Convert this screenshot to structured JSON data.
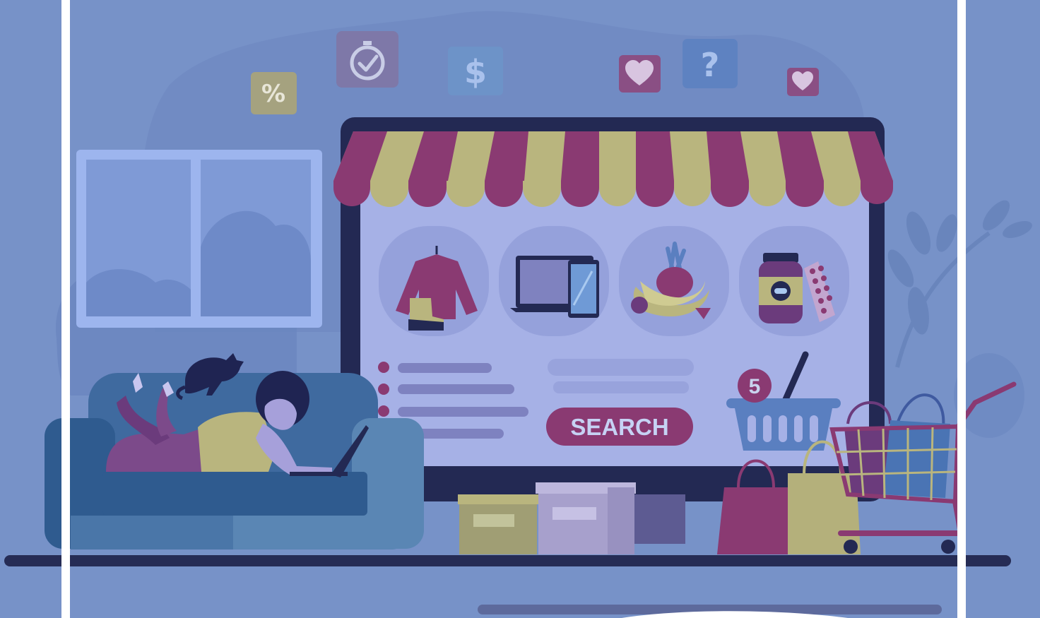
{
  "scene": {
    "search_button_label": "SEARCH",
    "basket_badge_count": "5",
    "floating_icons": {
      "percent": "%",
      "dollar": "$",
      "question": "?"
    },
    "colors": {
      "background": "#7792c8",
      "monitor_frame": "#232953",
      "screen": "#a6b1e6",
      "awning_stripe_a": "#8a3a72",
      "awning_stripe_b": "#b9b57e",
      "sofa": "#5a86b4",
      "search_button": "#8a3a72",
      "floor_line": "#262c55",
      "white_frame_lines": "#ffffff"
    },
    "product_categories": [
      "clothing-icon",
      "electronics-icon",
      "groceries-icon",
      "medicine-icon"
    ]
  }
}
